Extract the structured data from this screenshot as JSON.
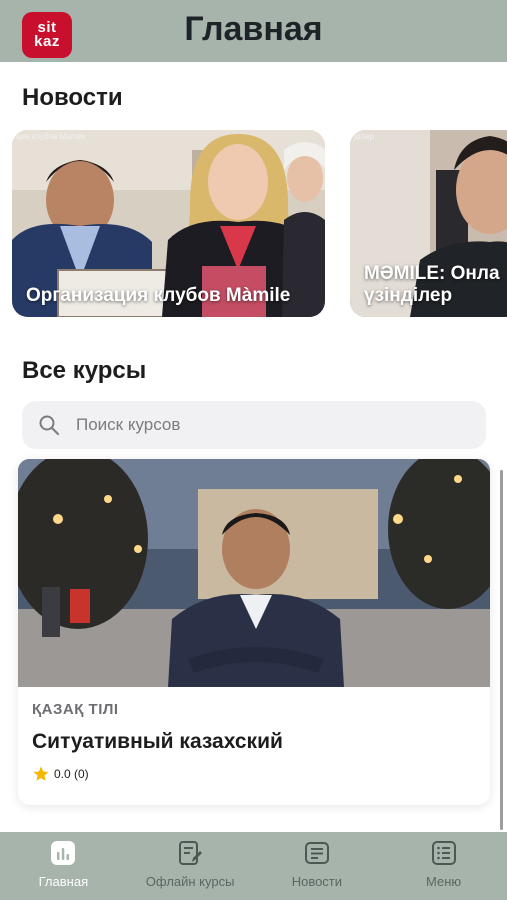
{
  "header": {
    "logo_line1": "sit",
    "logo_line2": "kaz",
    "title": "Главная"
  },
  "news": {
    "section_title": "Новости",
    "items": [
      {
        "small_caption": "ция клубов Màmile",
        "headline": "Организация клубов Màmile"
      },
      {
        "small_caption": "ділер",
        "headline": "МӘМІLE: Онла\nүзінділер"
      }
    ]
  },
  "courses": {
    "section_title": "Все курсы",
    "search": {
      "placeholder": "Поиск курсов",
      "value": ""
    },
    "items": [
      {
        "category": "ҚАЗАҚ ТІЛІ",
        "title": "Ситуативный казахский",
        "rating": "0.0 (0)"
      }
    ]
  },
  "tabbar": {
    "tabs": [
      {
        "label": "Главная",
        "icon": "chart-icon",
        "active": true
      },
      {
        "label": "Офлайн курсы",
        "icon": "edit-note-icon",
        "active": false
      },
      {
        "label": "Новости",
        "icon": "news-icon",
        "active": false
      },
      {
        "label": "Меню",
        "icon": "menu-list-icon",
        "active": false
      }
    ]
  },
  "colors": {
    "header_bg": "#a7b4ac",
    "brand_red": "#c8102e",
    "search_bg": "#f1f1f3",
    "star": "#f5b800"
  }
}
